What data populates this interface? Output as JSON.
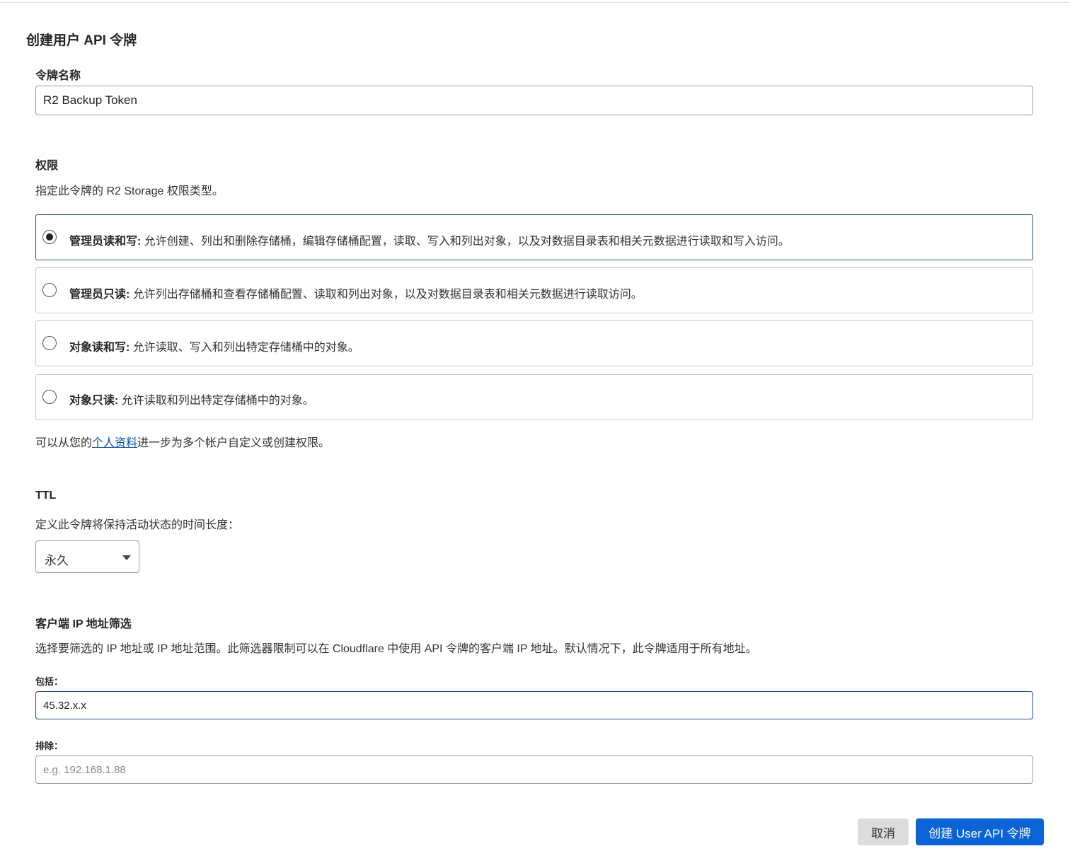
{
  "page": {
    "title": "创建用户 API 令牌"
  },
  "token_name": {
    "label": "令牌名称",
    "value": "R2 Backup Token"
  },
  "permissions": {
    "title": "权限",
    "description": "指定此令牌的 R2 Storage 权限类型。",
    "options": [
      {
        "label": "管理员读和写:",
        "description": "允许创建、列出和删除存储桶，编辑存储桶配置，读取、写入和列出对象，以及对数据目录表和相关元数据进行读取和写入访问。",
        "selected": true
      },
      {
        "label": "管理员只读:",
        "description": "允许列出存储桶和查看存储桶配置、读取和列出对象，以及对数据目录表和相关元数据进行读取访问。",
        "selected": false
      },
      {
        "label": "对象读和写:",
        "description": "允许读取、写入和列出特定存储桶中的对象。",
        "selected": false
      },
      {
        "label": "对象只读:",
        "description": "允许读取和列出特定存储桶中的对象。",
        "selected": false
      }
    ],
    "footer_prefix": "可以从您的",
    "footer_link": "个人资料",
    "footer_suffix": "进一步为多个帐户自定义或创建权限。"
  },
  "ttl": {
    "title": "TTL",
    "description": "定义此令牌将保持活动状态的时间长度：",
    "selected": "永久"
  },
  "ip_filter": {
    "title": "客户端 IP 地址筛选",
    "description": "选择要筛选的 IP 地址或 IP 地址范围。此筛选器限制可以在 Cloudflare 中使用 API 令牌的客户端 IP 地址。默认情况下，此令牌适用于所有地址。",
    "include_label": "包括：",
    "include_value": "45.32.x.x",
    "exclude_label": "排除：",
    "exclude_placeholder": "e.g. 192.168.1.88"
  },
  "actions": {
    "cancel": "取消",
    "create": "创建 User API 令牌"
  }
}
